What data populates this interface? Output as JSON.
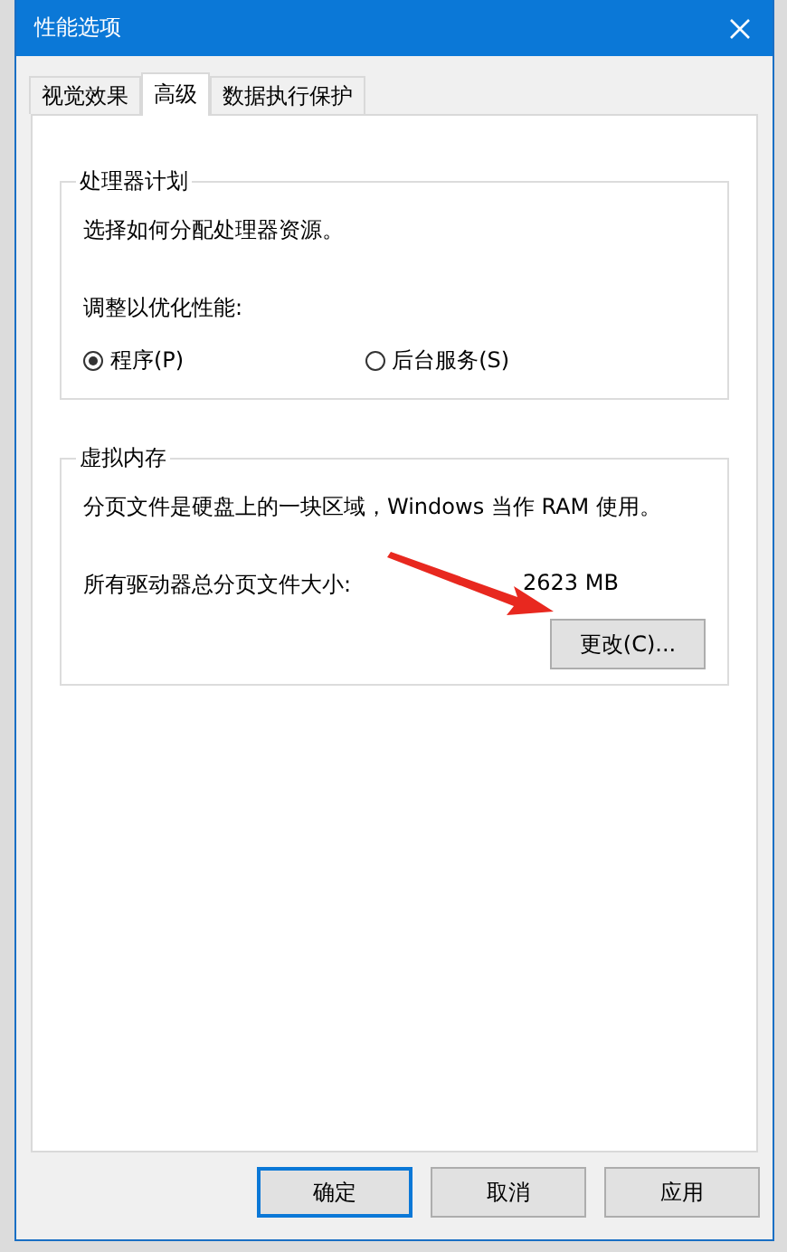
{
  "window": {
    "title": "性能选项"
  },
  "tabs": [
    {
      "label": "视觉效果",
      "selected": false
    },
    {
      "label": "高级",
      "selected": true
    },
    {
      "label": "数据执行保护",
      "selected": false
    }
  ],
  "processor_group": {
    "title": "处理器计划",
    "description": "选择如何分配处理器资源。",
    "prompt": "调整以优化性能:",
    "options": [
      {
        "label": "程序(P)",
        "selected": true
      },
      {
        "label": "后台服务(S)",
        "selected": false
      }
    ]
  },
  "memory_group": {
    "title": "虚拟内存",
    "description": "分页文件是硬盘上的一块区域，Windows 当作 RAM 使用。",
    "size_label": "所有驱动器总分页文件大小:",
    "size_value": "2623 MB",
    "button": "更改(C)..."
  },
  "buttons": [
    {
      "label": "确定",
      "default": true
    },
    {
      "label": "取消",
      "default": false
    },
    {
      "label": "应用",
      "default": false
    }
  ]
}
